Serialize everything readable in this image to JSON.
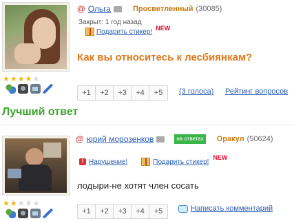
{
  "question": {
    "author": {
      "name": "Ольга",
      "rank": "Просветленный",
      "score": "(30085)"
    },
    "status": "Закрыт: 1 год назад",
    "gift_label": "Подарить стикер!",
    "new_badge": "NEW",
    "title": "Как вы относитесь к лесбиянкам?",
    "stars_filled": 4,
    "stars_total": 5,
    "votes": [
      "+1",
      "+2",
      "+3",
      "+4",
      "+5"
    ],
    "votes_count": "(3 голоса)",
    "rating_link": "Рейтинг вопросов"
  },
  "best_answer_heading": "Лучший ответ",
  "answer": {
    "author": {
      "name": "юрий морозенков",
      "rank": "Оракул",
      "score": "(50624)"
    },
    "on_answers_badge": "на ответах",
    "violation_label": "Нарушение!",
    "gift_label": "Подарить стикер!",
    "new_badge": "NEW",
    "text": "лодыри-не хотят член сосать",
    "stars_filled": 2,
    "stars_total": 5,
    "votes": [
      "+1",
      "+2",
      "+3",
      "+4",
      "+5"
    ],
    "comment_link": "Написать комментарий"
  },
  "colors": {
    "title": "#e0771c",
    "best_answer": "#3aa629",
    "link": "#2a5db0",
    "rank": "#c87a12",
    "new": "#e0102f"
  },
  "icons": [
    "at-icon",
    "mail-icon",
    "gift-icon",
    "violation-icon",
    "comment-icon",
    "star-icon",
    "user-icon",
    "camera-icon",
    "video-icon",
    "edit-icon"
  ]
}
